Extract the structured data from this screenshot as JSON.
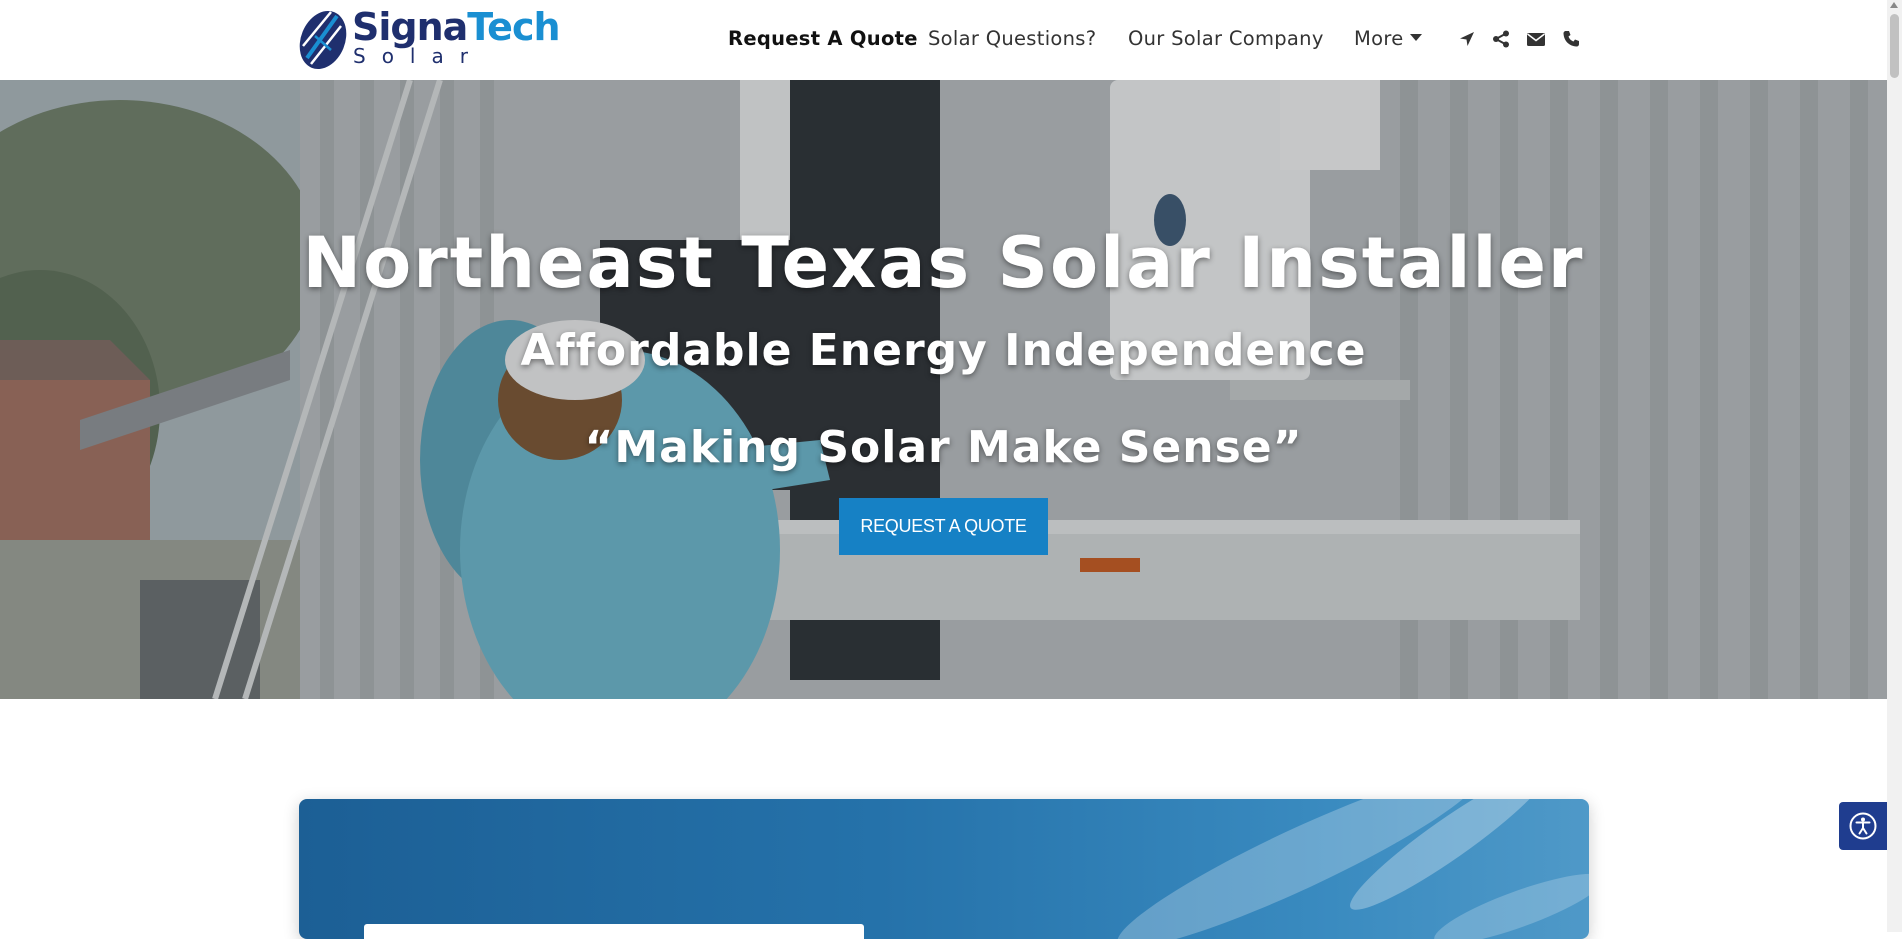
{
  "header": {
    "logo": {
      "word_signa": "Signa",
      "word_tech": "Tech",
      "word_solar": "Solar"
    },
    "nav": [
      {
        "label": "Request A Quote",
        "active": true
      },
      {
        "label": "Solar Questions?",
        "active": false
      },
      {
        "label": "Our Solar Company",
        "active": false
      },
      {
        "label": "More",
        "active": false,
        "has_dropdown": true
      }
    ],
    "icons": [
      "location-arrow-icon",
      "share-icon",
      "envelope-icon",
      "phone-icon"
    ]
  },
  "hero": {
    "title": "Northeast Texas Solar Installer",
    "subtitle": "Affordable Energy Independence",
    "tagline": "“Making Solar Make Sense”",
    "cta_label": "REQUEST A QUOTE"
  },
  "colors": {
    "brand_navy": "#1f2f6e",
    "brand_blue": "#1a8fd2",
    "cta_blue": "#1681c5",
    "accessibility_blue": "#1f3d8f"
  }
}
